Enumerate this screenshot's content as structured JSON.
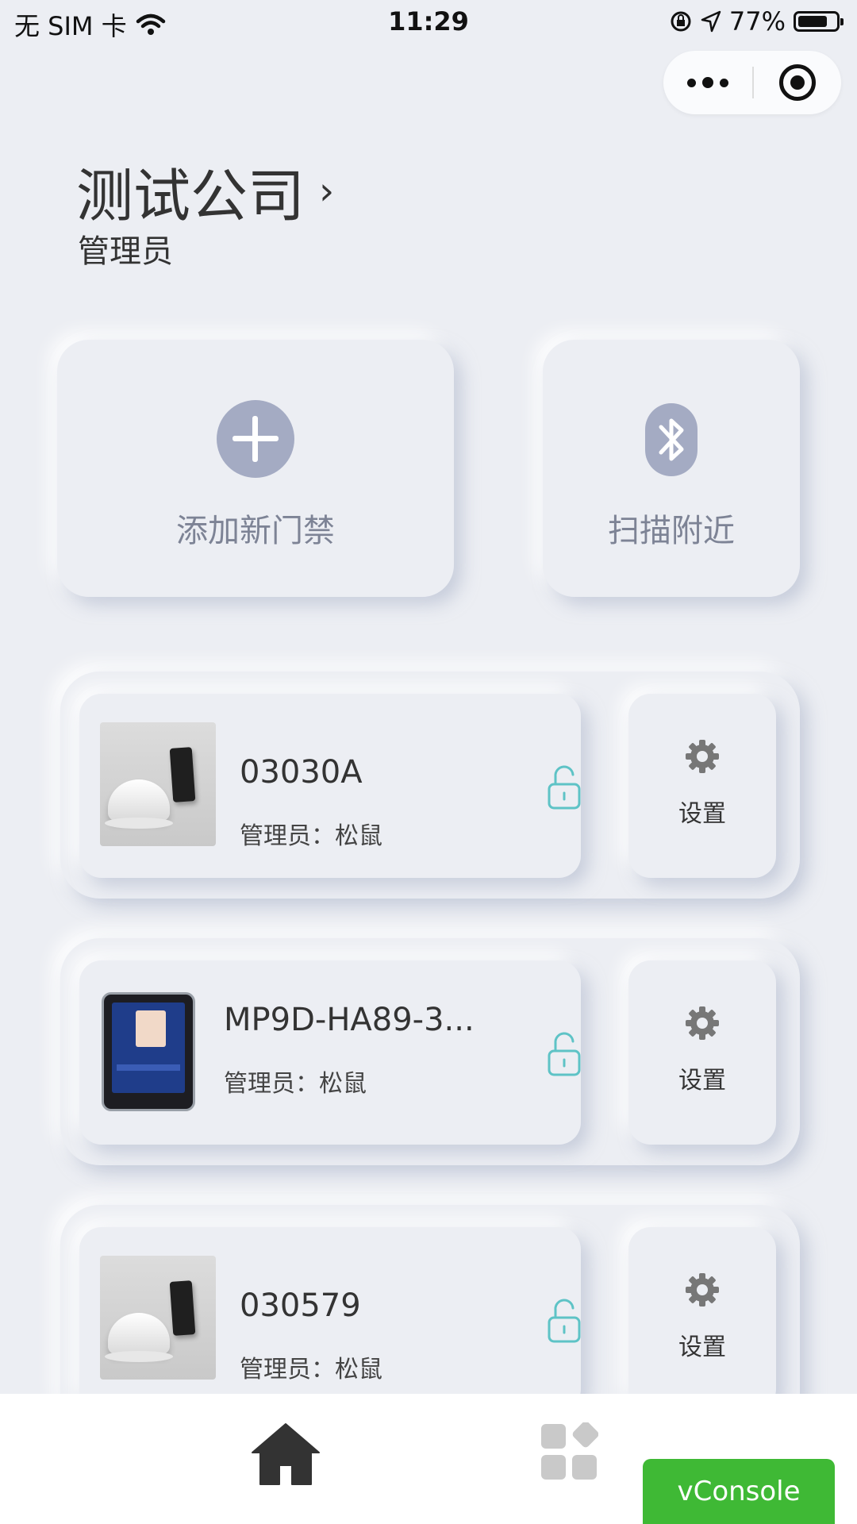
{
  "status_bar": {
    "carrier": "无 SIM 卡",
    "time": "11:29",
    "battery": "77%"
  },
  "header": {
    "company": "测试公司",
    "role": "管理员"
  },
  "actions": {
    "add_label": "添加新门禁",
    "scan_label": "扫描附近"
  },
  "devices": [
    {
      "name": "03030A",
      "admin": "管理员：松鼠",
      "settings_label": "设置",
      "image": "card-reader"
    },
    {
      "name": "MP9D-HA89-3...",
      "admin": "管理员：松鼠",
      "settings_label": "设置",
      "image": "face-terminal"
    },
    {
      "name": "030579",
      "admin": "管理员：松鼠",
      "settings_label": "设置",
      "image": "card-reader"
    }
  ],
  "tabbar": {
    "items": [
      "home-icon",
      "apps-grid-icon"
    ]
  },
  "vconsole": {
    "label": "vConsole"
  },
  "colors": {
    "background": "#eceef3",
    "icon_gray": "#a4abc3",
    "lock_teal": "#5ec3c6",
    "vconsole_green": "#3fb935"
  }
}
